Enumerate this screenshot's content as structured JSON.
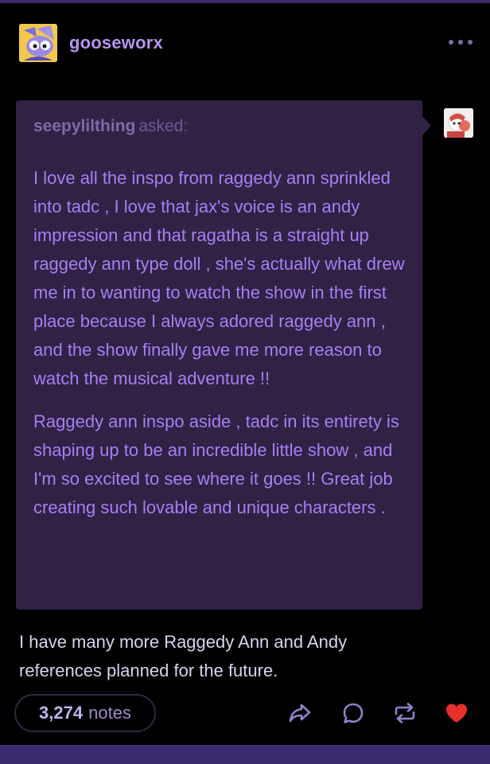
{
  "post": {
    "blog_name": "gooseworx",
    "ask": {
      "asker": "seepylilthing",
      "asked_label": "asked:",
      "paragraphs": [
        "I love all the inspo from raggedy ann sprinkled into tadc , I love that jax's voice is an andy impression and that ragatha is a straight up raggedy ann type doll , she's actually what drew me in to wanting to watch the show in the first place because I always adored raggedy ann , and the show finally gave me more reason to watch the musical adventure !!",
        "Raggedy ann inspo aside , tadc in its entirety is shaping up to be an incredible little show , and I'm so excited to see where it goes !! Great job creating such lovable and unique characters ."
      ]
    },
    "reply": "I have many more Raggedy Ann and Andy references planned for the future.",
    "notes": {
      "count": "3,274",
      "label": "notes"
    }
  },
  "icons": {
    "more": "more-horizontal-icon",
    "share": "share-icon",
    "reply": "reply-bubble-icon",
    "reblog": "reblog-icon",
    "like": "heart-icon"
  },
  "colors": {
    "background": "#000000",
    "accent": "#b495f0",
    "ask_card": "#2f2245",
    "ask_text": "#a87ff2",
    "like_red": "#e8302b",
    "bottom_bar": "#3b2a6e"
  }
}
